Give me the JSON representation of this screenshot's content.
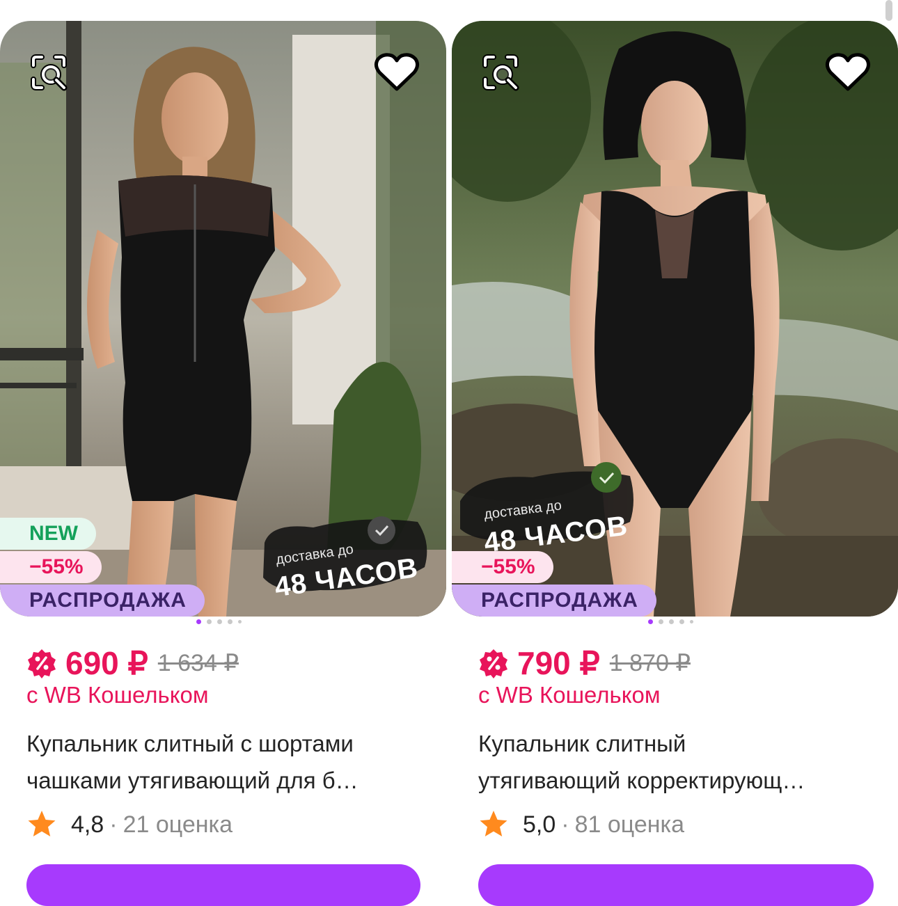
{
  "products": [
    {
      "badge_new": "NEW",
      "discount": "−55%",
      "sale_label": "РАСПРОДАЖА",
      "delivery_small": "доставка до",
      "delivery_big": "48 ЧАСОВ",
      "price": "690 ₽",
      "old_price": "1 634 ₽",
      "wallet_text": "с WB Кошельком",
      "title_line1": "Купальник слитный с шортами",
      "title_line2": "чашками утягивающий для б…",
      "rating": "4,8",
      "separator": "·",
      "reviews": "21 оценка",
      "image_count": 5,
      "active_image": 0
    },
    {
      "discount": "−55%",
      "sale_label": "РАСПРОДАЖА",
      "delivery_small": "доставка до",
      "delivery_big": "48 ЧАСОВ",
      "price": "790 ₽",
      "old_price": "1 870 ₽",
      "wallet_text": "с WB Кошельком",
      "title_line1": "Купальник слитный",
      "title_line2": "утягивающий корректирующ…",
      "rating": "5,0",
      "separator": "·",
      "reviews": "81 оценка",
      "image_count": 5,
      "active_image": 0
    }
  ],
  "icons": {
    "search": "image-search-icon",
    "favorite": "heart-icon",
    "wallet": "wallet-discount-icon",
    "star": "star-icon",
    "delivery": "clock-check-icon"
  },
  "colors": {
    "accent": "#a73afd",
    "price": "#e8145a",
    "rating_star": "#ff8a1e",
    "new_badge": "#14a15a",
    "sale_badge": "#cfaef5"
  }
}
